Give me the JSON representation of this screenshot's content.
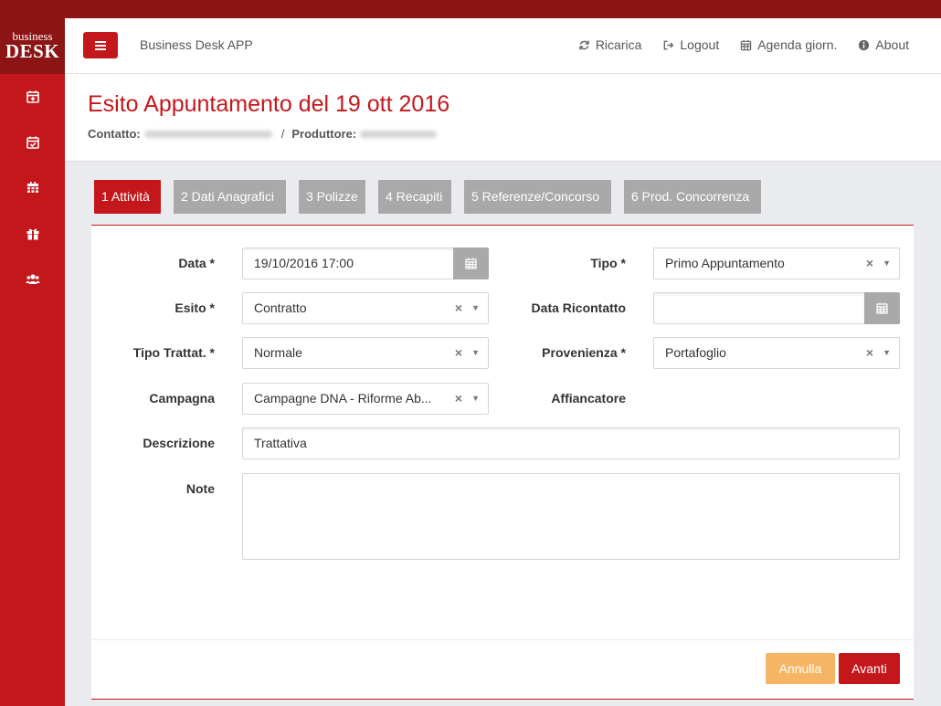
{
  "logo": {
    "line1": "business",
    "line2": "DESK"
  },
  "sidebar": {
    "icons": [
      "calendar-plus-icon",
      "calendar-check-icon",
      "calendar-icon",
      "gift-icon",
      "users-icon"
    ]
  },
  "header": {
    "app_title": "Business Desk APP",
    "nav": [
      {
        "label": "Ricarica",
        "icon": "refresh-icon"
      },
      {
        "label": "Logout",
        "icon": "logout-icon"
      },
      {
        "label": "Agenda giorn.",
        "icon": "calendar-icon"
      },
      {
        "label": "About",
        "icon": "info-icon"
      }
    ]
  },
  "page": {
    "title": "Esito Appuntamento del 19 ott 2016",
    "contact_label": "Contatto:",
    "separator": "/",
    "producer_label": "Produttore:"
  },
  "tabs": [
    {
      "label": "1 Attività",
      "active": true
    },
    {
      "label": "2 Dati Anagrafici",
      "active": false
    },
    {
      "label": "3 Polizze",
      "active": false
    },
    {
      "label": "4 Recapiti",
      "active": false
    },
    {
      "label": "5 Referenze/Concorso",
      "active": false
    },
    {
      "label": "6 Prod. Concorrenza",
      "active": false
    }
  ],
  "form": {
    "data_label": "Data *",
    "data_value": "19/10/2016 17:00",
    "tipo_label": "Tipo *",
    "tipo_value": "Primo Appuntamento",
    "esito_label": "Esito *",
    "esito_value": "Contratto",
    "data_ricontatto_label": "Data Ricontatto",
    "data_ricontatto_value": "",
    "tipo_trattat_label": "Tipo Trattat. *",
    "tipo_trattat_value": "Normale",
    "provenienza_label": "Provenienza *",
    "provenienza_value": "Portafoglio",
    "campagna_label": "Campagna",
    "campagna_value": "Campagne DNA - Riforme Ab...",
    "affiancatore_label": "Affiancatore",
    "descrizione_label": "Descrizione",
    "descrizione_value": "Trattativa",
    "note_label": "Note",
    "note_value": "",
    "clear_glyph": "×",
    "caret_glyph": "▼"
  },
  "buttons": {
    "cancel": "Annulla",
    "next": "Avanti"
  },
  "colors": {
    "brand_red": "#c4171c",
    "dark_red": "#8c1414",
    "cancel_orange": "#f6b564",
    "tab_grey": "#a9a9a9"
  }
}
